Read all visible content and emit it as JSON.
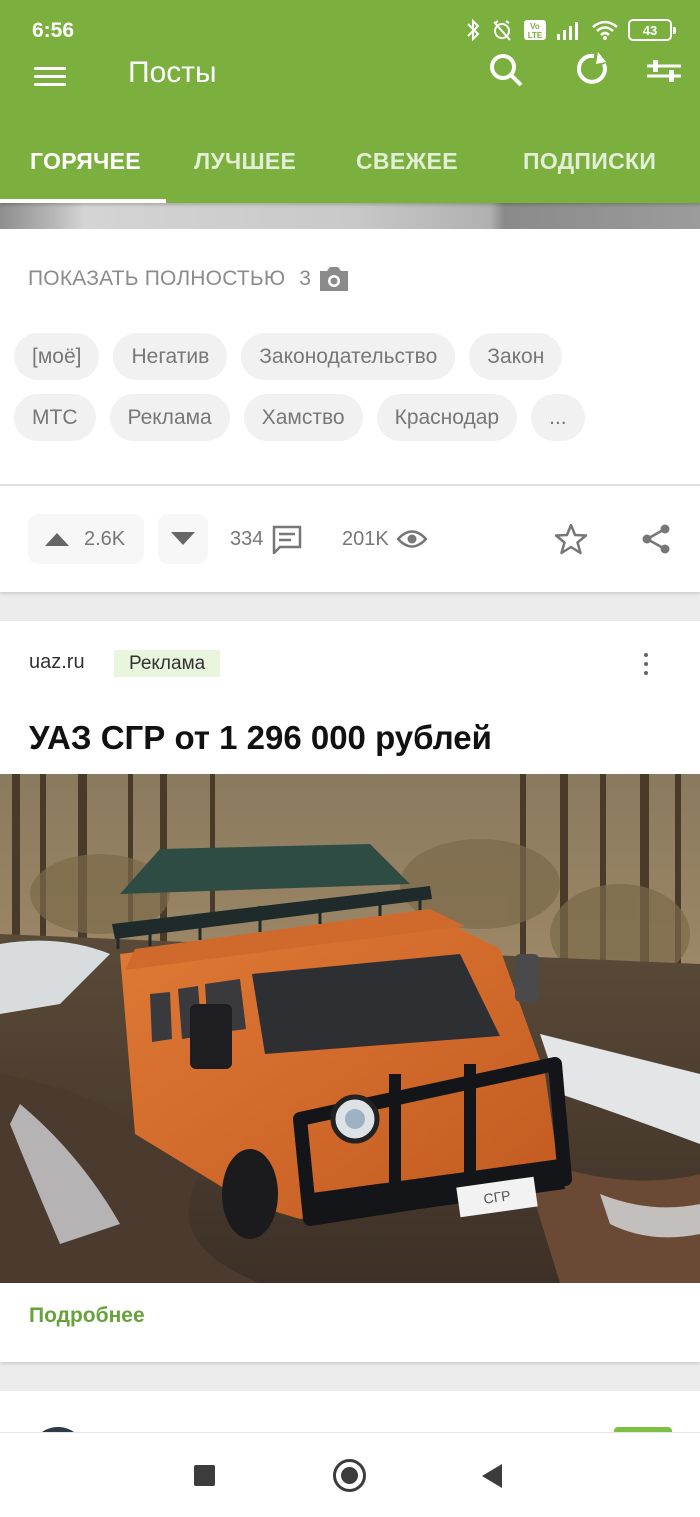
{
  "status_bar": {
    "time": "6:56",
    "battery": "43",
    "volte": "Vo LTE"
  },
  "toolbar": {
    "title": "Посты"
  },
  "tabs": [
    {
      "label": "ГОРЯЧЕЕ",
      "active": true
    },
    {
      "label": "ЛУЧШЕЕ",
      "active": false
    },
    {
      "label": "СВЕЖЕЕ",
      "active": false
    },
    {
      "label": "ПОДПИСКИ",
      "active": false
    }
  ],
  "post": {
    "show_full_label": "ПОКАЗАТЬ ПОЛНОСТЬЮ",
    "image_count": "3",
    "tags_row1": [
      "[моё]",
      "Негатив",
      "Законодательство",
      "Закон"
    ],
    "tags_row2": [
      "МТС",
      "Реклама",
      "Хамство",
      "Краснодар",
      "..."
    ],
    "rating": "2.6K",
    "comments": "334",
    "views": "201K"
  },
  "ad": {
    "domain": "uaz.ru",
    "badge": "Реклама",
    "title": "УАЗ СГР от 1 296 000 рублей",
    "plate": "СГР",
    "link_label": "Подробнее"
  },
  "colors": {
    "brand_green": "#7bb03f",
    "link_green": "#67a33b",
    "ad_badge_bg": "#e9f5dc"
  }
}
